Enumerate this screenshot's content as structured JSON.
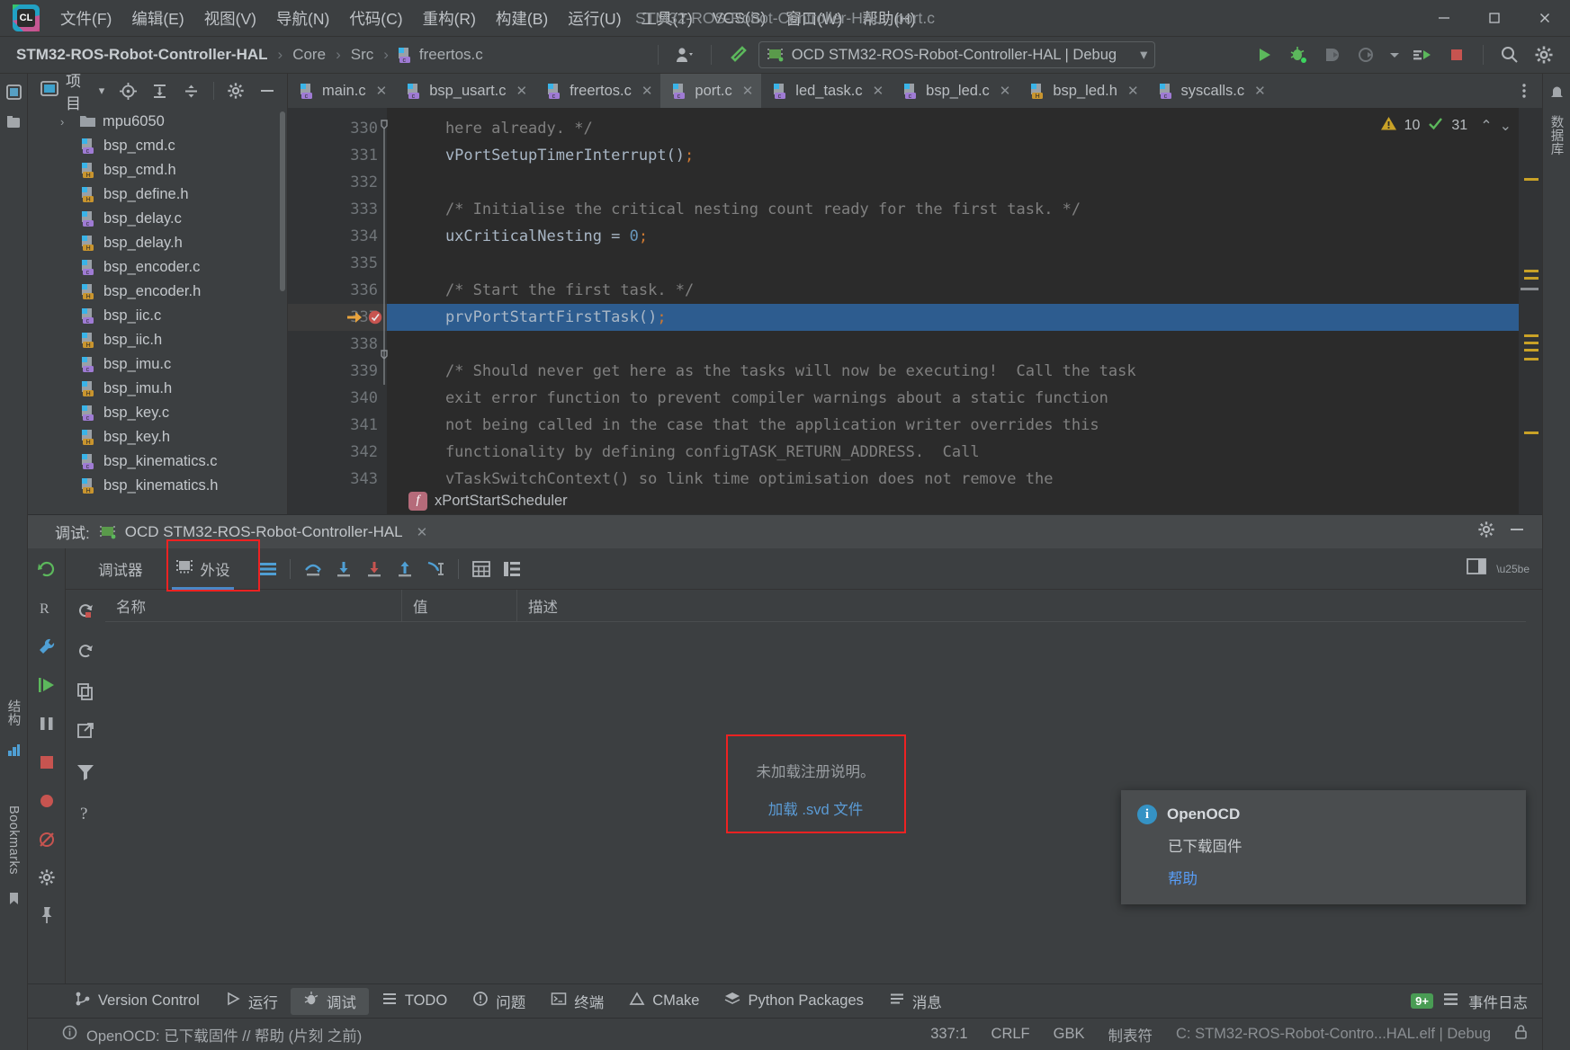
{
  "window": {
    "title": "STM32-ROS-Robot-Controller-HAL - port.c",
    "minimize": "─",
    "maximize": "□",
    "close": "✕"
  },
  "menu": {
    "items": [
      {
        "label": "文件(F)",
        "name": "menu-file"
      },
      {
        "label": "编辑(E)",
        "name": "menu-edit"
      },
      {
        "label": "视图(V)",
        "name": "menu-view"
      },
      {
        "label": "导航(N)",
        "name": "menu-navigate"
      },
      {
        "label": "代码(C)",
        "name": "menu-code"
      },
      {
        "label": "重构(R)",
        "name": "menu-refactor"
      },
      {
        "label": "构建(B)",
        "name": "menu-build"
      },
      {
        "label": "运行(U)",
        "name": "menu-run"
      },
      {
        "label": "工具(T)",
        "name": "menu-tools"
      },
      {
        "label": "VCS(S)",
        "name": "menu-vcs"
      },
      {
        "label": "窗口(W)",
        "name": "menu-window"
      },
      {
        "label": "帮助(H)",
        "name": "menu-help"
      }
    ]
  },
  "navbar": {
    "breadcrumbs": [
      "STM32-ROS-Robot-Controller-HAL",
      "Core",
      "Src",
      "freertos.c"
    ],
    "separator": "›",
    "run_config": "OCD STM32-ROS-Robot-Controller-HAL | Debug",
    "dropdown_caret": "▾"
  },
  "project": {
    "title": "项目",
    "caret": "▾",
    "tree": [
      {
        "label": "mpu6050",
        "type": "folder",
        "expanded": false
      },
      {
        "label": "bsp_cmd.c",
        "type": "c"
      },
      {
        "label": "bsp_cmd.h",
        "type": "h"
      },
      {
        "label": "bsp_define.h",
        "type": "h"
      },
      {
        "label": "bsp_delay.c",
        "type": "c"
      },
      {
        "label": "bsp_delay.h",
        "type": "h"
      },
      {
        "label": "bsp_encoder.c",
        "type": "c"
      },
      {
        "label": "bsp_encoder.h",
        "type": "h"
      },
      {
        "label": "bsp_iic.c",
        "type": "c"
      },
      {
        "label": "bsp_iic.h",
        "type": "h"
      },
      {
        "label": "bsp_imu.c",
        "type": "c"
      },
      {
        "label": "bsp_imu.h",
        "type": "h"
      },
      {
        "label": "bsp_key.c",
        "type": "c"
      },
      {
        "label": "bsp_key.h",
        "type": "h"
      },
      {
        "label": "bsp_kinematics.c",
        "type": "c"
      },
      {
        "label": "bsp_kinematics.h",
        "type": "h"
      }
    ]
  },
  "editor": {
    "tabs": [
      {
        "label": "main.c",
        "type": "c",
        "active": false
      },
      {
        "label": "bsp_usart.c",
        "type": "c",
        "active": false
      },
      {
        "label": "freertos.c",
        "type": "c",
        "active": false
      },
      {
        "label": "port.c",
        "type": "c",
        "active": true
      },
      {
        "label": "led_task.c",
        "type": "c",
        "active": false
      },
      {
        "label": "bsp_led.c",
        "type": "c",
        "active": false
      },
      {
        "label": "bsp_led.h",
        "type": "h",
        "active": false
      },
      {
        "label": "syscalls.c",
        "type": "c",
        "active": false
      }
    ],
    "close_glyph": "✕",
    "inspection": {
      "warnings": "10",
      "checks": "31",
      "warn_icon": "⚠",
      "ok_icon": "✔",
      "up": "⌃",
      "down": "⌄"
    },
    "lines": [
      {
        "num": "330",
        "text": "    here already. */",
        "kind": "comment"
      },
      {
        "num": "331",
        "text": "    vPortSetupTimerInterrupt();",
        "kind": "code"
      },
      {
        "num": "332",
        "text": "",
        "kind": "code"
      },
      {
        "num": "333",
        "text": "    /* Initialise the critical nesting count ready for the first task. */",
        "kind": "comment"
      },
      {
        "num": "334",
        "text": "    uxCriticalNesting = 0;",
        "kind": "code"
      },
      {
        "num": "335",
        "text": "",
        "kind": "code"
      },
      {
        "num": "336",
        "text": "    /* Start the first task. */",
        "kind": "comment"
      },
      {
        "num": "337",
        "text": "    prvPortStartFirstTask();",
        "kind": "code",
        "highlight": true,
        "breakpoint": true,
        "execution_pointer": true
      },
      {
        "num": "338",
        "text": "",
        "kind": "code"
      },
      {
        "num": "339",
        "text": "    /* Should never get here as the tasks will now be executing!  Call the task",
        "kind": "comment"
      },
      {
        "num": "340",
        "text": "    exit error function to prevent compiler warnings about a static function",
        "kind": "comment"
      },
      {
        "num": "341",
        "text": "    not being called in the case that the application writer overrides this",
        "kind": "comment"
      },
      {
        "num": "342",
        "text": "    functionality by defining configTASK_RETURN_ADDRESS.  Call",
        "kind": "comment"
      },
      {
        "num": "343",
        "text": "    vTaskSwitchContext() so link time optimisation does not remove the",
        "kind": "comment"
      }
    ],
    "breadcrumb_function": "xPortStartScheduler",
    "breadcrumb_function_badge": "f"
  },
  "debug": {
    "label": "调试:",
    "session": "OCD STM32-ROS-Robot-Controller-HAL",
    "close_glyph": "✕",
    "settings_glyph": "⚙",
    "minimize_glyph": "─",
    "tabs": [
      {
        "label": "调试器",
        "name": "tab-debugger",
        "active": false
      },
      {
        "label": "外设",
        "name": "tab-peripherals",
        "active": true,
        "highlighted": true
      }
    ],
    "table": {
      "headers": [
        "名称",
        "值",
        "描述"
      ]
    },
    "empty": {
      "message": "未加载注册说明。",
      "link": "加载 .svd 文件"
    }
  },
  "notification": {
    "title": "OpenOCD",
    "body": "已下载固件",
    "link": "帮助",
    "icon": "i"
  },
  "bottom_bar": {
    "items": [
      {
        "label": "Version Control",
        "name": "toolwindow-version-control",
        "icon": "branch-icon",
        "active": false
      },
      {
        "label": "运行",
        "name": "toolwindow-run",
        "icon": "play-icon",
        "active": false
      },
      {
        "label": "调试",
        "name": "toolwindow-debug",
        "icon": "bug-icon",
        "active": true
      },
      {
        "label": "TODO",
        "name": "toolwindow-todo",
        "icon": "list-icon",
        "active": false
      },
      {
        "label": "问题",
        "name": "toolwindow-problems",
        "icon": "error-icon",
        "active": false
      },
      {
        "label": "终端",
        "name": "toolwindow-terminal",
        "icon": "terminal-icon",
        "active": false
      },
      {
        "label": "CMake",
        "name": "toolwindow-cmake",
        "icon": "triangle-icon",
        "active": false
      },
      {
        "label": "Python Packages",
        "name": "toolwindow-python-packages",
        "icon": "layers-icon",
        "active": false
      },
      {
        "label": "消息",
        "name": "toolwindow-messages",
        "icon": "message-icon",
        "active": false
      }
    ],
    "right": {
      "label": "事件日志",
      "badge": "9+"
    }
  },
  "statusbar": {
    "left": "OpenOCD: 已下载固件 // 帮助 (片刻 之前)",
    "caret": "337:1",
    "line_sep": "CRLF",
    "encoding": "GBK",
    "indent": "制表符",
    "target": "C: STM32-ROS-Robot-Contro...HAL.elf | Debug",
    "lock": "🔒"
  },
  "rails": {
    "left_top": [
      "项目",
      "结构",
      "Bookmarks"
    ],
    "right_top": "数据库"
  },
  "colors": {
    "accent_blue": "#4a88c7",
    "highlight_line": "#2d5c8f",
    "red_outline": "#ee2222",
    "link_blue": "#5b9bd5",
    "green": "#499c54"
  }
}
